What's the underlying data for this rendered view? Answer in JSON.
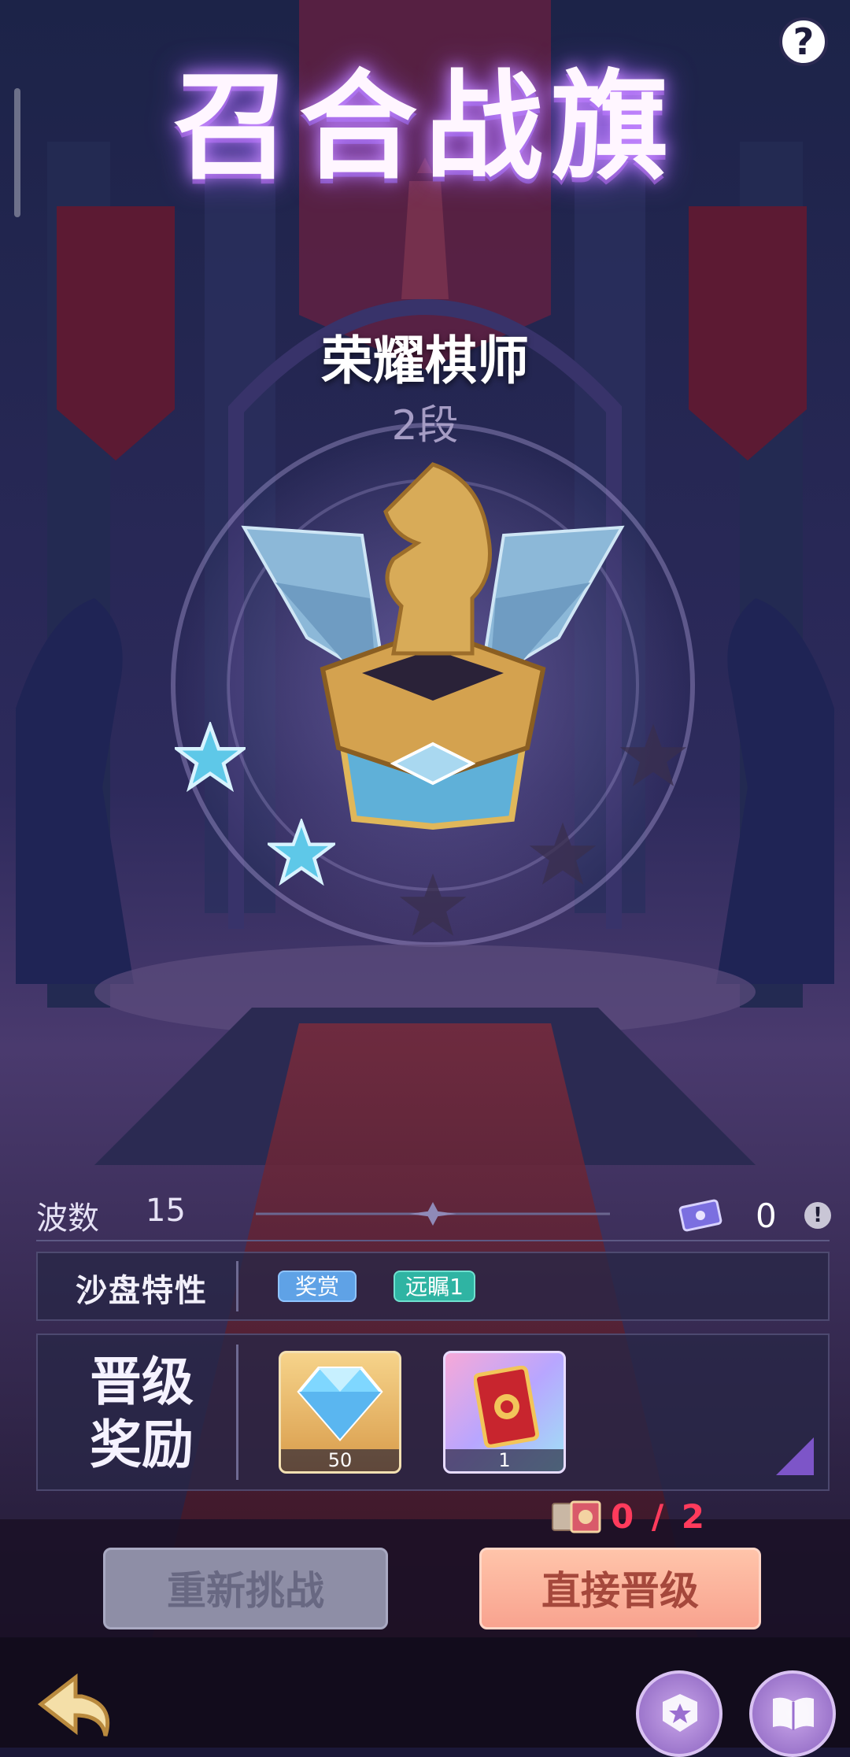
{
  "header": {
    "title": "召合战旗",
    "help_label": "?"
  },
  "rank": {
    "name": "荣耀棋师",
    "tier": "2段"
  },
  "stats": {
    "wave_label": "波数",
    "wave_value": "15",
    "ticket_count": "0",
    "warn_label": "!"
  },
  "traits": {
    "label": "沙盘特性",
    "tags": [
      "奖赏",
      "远瞩1"
    ]
  },
  "rewards": {
    "label_line1": "晋级",
    "label_line2": "奖励",
    "items": [
      {
        "name": "diamond",
        "count": "50"
      },
      {
        "name": "card-pack",
        "count": "1"
      }
    ]
  },
  "progress": {
    "text": "0 / 2"
  },
  "buttons": {
    "retry": "重新挑战",
    "promote": "直接晋级"
  },
  "colors": {
    "accent_red": "#ff3b5c",
    "promote_button": "#f8a38f",
    "retry_button": "#8e8ea6"
  }
}
